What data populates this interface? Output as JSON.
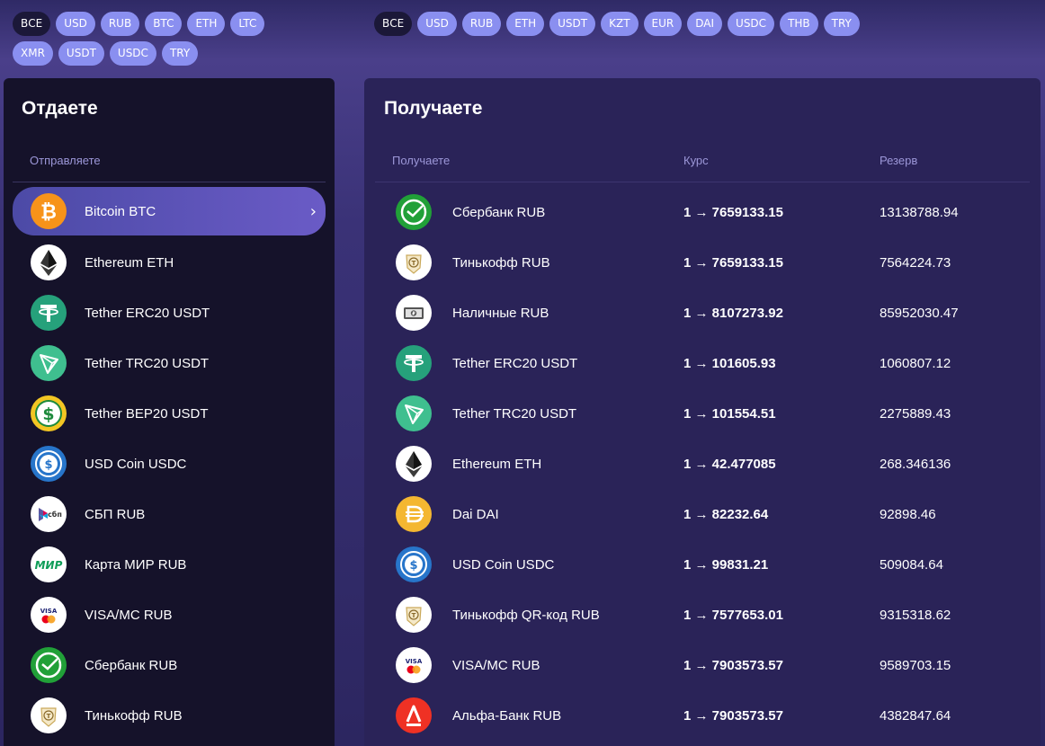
{
  "filters_left": [
    "ВСЕ",
    "USD",
    "RUB",
    "BTC",
    "ETH",
    "LTC",
    "XMR",
    "USDT",
    "USDC",
    "TRY"
  ],
  "filters_right": [
    "ВСЕ",
    "USD",
    "RUB",
    "ETH",
    "USDT",
    "KZT",
    "EUR",
    "DAI",
    "USDC",
    "THB",
    "TRY"
  ],
  "give": {
    "title": "Отдаете",
    "column": "Отправляете",
    "items": [
      {
        "name": "Bitcoin BTC",
        "icon": "bitcoin-icon"
      },
      {
        "name": "Ethereum ETH",
        "icon": "ethereum-icon"
      },
      {
        "name": "Tether ERC20 USDT",
        "icon": "tether-icon"
      },
      {
        "name": "Tether TRC20 USDT",
        "icon": "tron-icon"
      },
      {
        "name": "Tether BEP20 USDT",
        "icon": "dollar-icon"
      },
      {
        "name": "USD Coin USDC",
        "icon": "usdc-icon"
      },
      {
        "name": "СБП RUB",
        "icon": "sbp-icon"
      },
      {
        "name": "Карта МИР RUB",
        "icon": "mir-icon"
      },
      {
        "name": "VISA/MC RUB",
        "icon": "visa-mc-icon"
      },
      {
        "name": "Сбербанк RUB",
        "icon": "sberbank-icon"
      },
      {
        "name": "Тинькофф RUB",
        "icon": "tinkoff-icon"
      }
    ]
  },
  "get": {
    "title": "Получаете",
    "columns": {
      "name": "Получаете",
      "rate": "Курс",
      "reserve": "Резерв"
    },
    "items": [
      {
        "name": "Сбербанк RUB",
        "rate": "1 → 7659133.15",
        "reserve": "13138788.94",
        "icon": "sberbank-icon"
      },
      {
        "name": "Тинькофф RUB",
        "rate": "1 → 7659133.15",
        "reserve": "7564224.73",
        "icon": "tinkoff-icon"
      },
      {
        "name": "Наличные RUB",
        "rate": "1 → 8107273.92",
        "reserve": "85952030.47",
        "icon": "cash-icon"
      },
      {
        "name": "Tether ERC20 USDT",
        "rate": "1 → 101605.93",
        "reserve": "1060807.12",
        "icon": "tether-icon"
      },
      {
        "name": "Tether TRC20 USDT",
        "rate": "1 → 101554.51",
        "reserve": "2275889.43",
        "icon": "tron-icon"
      },
      {
        "name": "Ethereum ETH",
        "rate": "1 → 42.477085",
        "reserve": "268.346136",
        "icon": "ethereum-icon"
      },
      {
        "name": "Dai DAI",
        "rate": "1 → 82232.64",
        "reserve": "92898.46",
        "icon": "dai-icon"
      },
      {
        "name": "USD Coin USDC",
        "rate": "1 → 99831.21",
        "reserve": "509084.64",
        "icon": "usdc-icon"
      },
      {
        "name": "Тинькофф QR-код RUB",
        "rate": "1 → 7577653.01",
        "reserve": "9315318.62",
        "icon": "tinkoff-icon"
      },
      {
        "name": "VISA/MC RUB",
        "rate": "1 → 7903573.57",
        "reserve": "9589703.15",
        "icon": "visa-mc-icon"
      },
      {
        "name": "Альфа-Банк RUB",
        "rate": "1 → 7903573.57",
        "reserve": "4382847.64",
        "icon": "alfabank-icon"
      }
    ]
  }
}
